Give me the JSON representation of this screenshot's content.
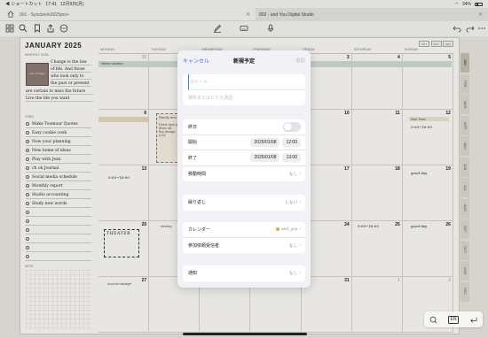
{
  "status": {
    "left": "◀ ショートカット",
    "time": "17:41",
    "date": "12月9日(月)",
    "battery": "34%"
  },
  "tabs": [
    {
      "label": "001 - Syncbook2025pro+"
    },
    {
      "label": "002 - and You Digital Studio"
    }
  ],
  "planner": {
    "month_title": "JANUARY 2025",
    "goal_label": "MONTHLY GOAL",
    "photo_caption": "love & happy",
    "goals": [
      "Change is the law",
      "of life. And those",
      "who look only to",
      "the past or present",
      "are certain to miss the future",
      "Live the life you want"
    ],
    "todo_label": "TODO",
    "todos": [
      "Make Toomour Quotes",
      "Easy cookie cook",
      "Now your planning",
      "New home of ideas",
      "Play with Jean",
      "ch ok Journal",
      "Social media schedule",
      "Monthly report",
      "Studio accounting",
      "Study new words",
      "",
      "",
      "",
      "",
      "",
      ""
    ],
    "note_label": "NOTE",
    "days": [
      "MONDAY",
      "TUESDAY",
      "WEDNESDAY",
      "THURSDAY",
      "FRIDAY",
      "SATURDAY",
      "SUNDAY"
    ],
    "nums": [
      [
        "30",
        "31",
        "1",
        "2",
        "3",
        "4",
        "5"
      ],
      [
        "6",
        "7",
        "8",
        "9",
        "10",
        "11",
        "12"
      ],
      [
        "13",
        "14",
        "15",
        "16",
        "17",
        "18",
        "19"
      ],
      [
        "20",
        "21",
        "22",
        "23",
        "24",
        "25",
        "26"
      ],
      [
        "27",
        "28",
        "29",
        "30",
        "31",
        "1",
        "2"
      ]
    ],
    "mini_buttons": [
      "OCT",
      "NOV",
      "DEC"
    ],
    "winter_vacation": "Winter vacation",
    "events": {
      "family_dinner": "Family new lunch",
      "meeting": "Meeting",
      "start_team": "Start Team",
      "time1": "9:00~16:00",
      "time2": "9:00~16:00",
      "good_day": "good day",
      "good_day2": "good day",
      "theater": "THEATER",
      "time3": "9:00~16:00",
      "sticky_lines": [
        "Draw new photo",
        "draw all",
        "fun design",
        "a lot"
      ],
      "account_manager": "Account manager",
      "meeting2": "Meeting"
    }
  },
  "months": [
    "JAN",
    "FEB",
    "MAR",
    "APR",
    "MAY",
    "JUN",
    "JUL",
    "AUG",
    "SEP",
    "OCT",
    "NOV",
    "DEC"
  ],
  "modal": {
    "cancel": "キャンセル",
    "title": "新規予定",
    "add": "追加",
    "title_placeholder": "タイトル",
    "location_placeholder": "場所またはビデオ通話",
    "all_day": "終日",
    "start": "開始",
    "start_date": "2025/01/08",
    "start_time": "12:00",
    "end": "終了",
    "end_date": "2025/01/08",
    "end_time": "13:00",
    "travel_time": "移動時間",
    "travel_value": "なし",
    "repeat": "繰り返し",
    "repeat_value": "しない",
    "calendar": "カレンダー",
    "calendar_value": "and_you",
    "invitees": "参加依頼受信者",
    "invitees_value": "なし",
    "alert": "通知",
    "alert_value": "なし"
  },
  "bottom": {
    "lang": "EN"
  }
}
